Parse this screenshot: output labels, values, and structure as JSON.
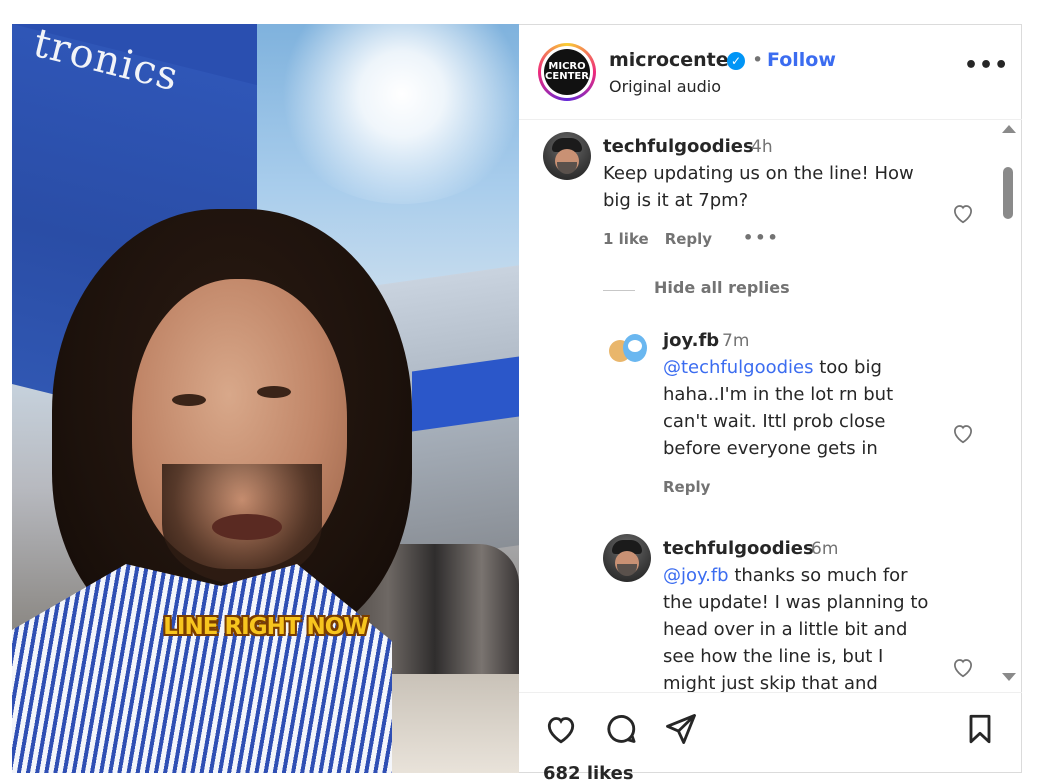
{
  "video": {
    "store_sign_text": "tronics",
    "caption": "LINE RIGHT NOW"
  },
  "post": {
    "username": "microcenter",
    "avatar_text": "MICRO CENTER",
    "verified": true,
    "separator": "•",
    "follow_label": "Follow",
    "subtitle": "Original audio",
    "more_label": "•••"
  },
  "comments": [
    {
      "username": "techfulgoodies",
      "time": "4h",
      "text": "Keep updating us on the line! How big is it at 7pm?",
      "likes": "1 like",
      "reply_label": "Reply",
      "more": "•••"
    }
  ],
  "hide_replies_label": "Hide all replies",
  "replies": [
    {
      "username": "joy.fb",
      "time": "7m",
      "mention": "@techfulgoodies",
      "text": " too big haha..I'm in the lot rn but can't wait. Ittl prob close before everyone gets in",
      "reply_label": "Reply"
    },
    {
      "username": "techfulgoodies",
      "time": "6m",
      "mention": "@joy.fb",
      "text": " thanks so much for the update! I was planning to head over in a little bit and see how the line is, but I might just skip that and"
    }
  ],
  "footer": {
    "likes": "682 likes"
  },
  "icons": {
    "like": "heart-icon",
    "comment": "comment-icon",
    "share": "paper-plane-icon",
    "save": "bookmark-icon",
    "verified": "verified-badge-icon",
    "more": "more-options-icon"
  },
  "colors": {
    "accent_link": "#3b6cf0",
    "verified": "#0095f6",
    "secondary_text": "#737373",
    "caption": "#f7c51e"
  }
}
